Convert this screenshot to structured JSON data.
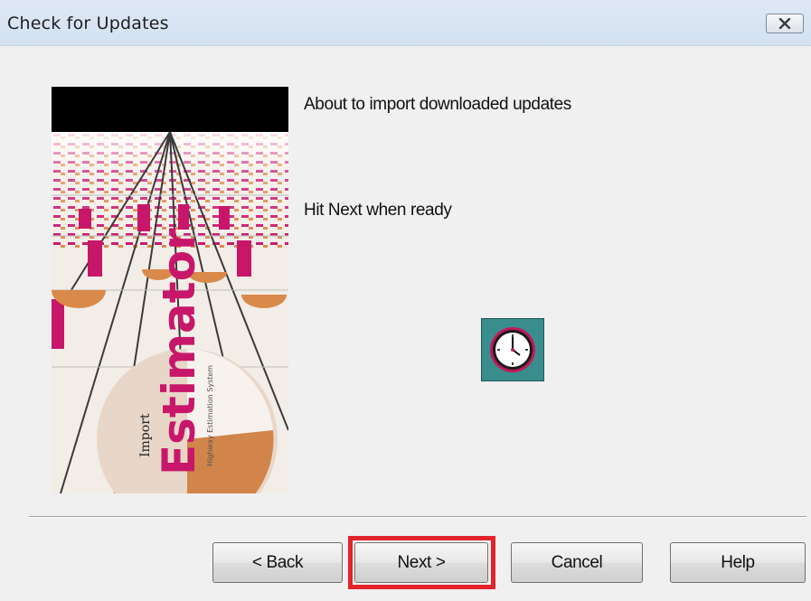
{
  "window": {
    "title": "Check for Updates",
    "close_icon": "close-icon"
  },
  "banner": {
    "image": "estimator-banner-image",
    "word_top": "Import",
    "word_main": "Estimator",
    "word_sub": "Highway Estimation System"
  },
  "content": {
    "message_1": "About to import downloaded updates",
    "message_2": "Hit Next when ready",
    "status_icon": "clock-icon"
  },
  "buttons": {
    "back_label": "< Back",
    "next_label": "Next >",
    "cancel_label": "Cancel",
    "help_label": "Help"
  },
  "colors": {
    "highlight": "#e3232b",
    "clock_background": "#3a8d8d",
    "clock_rim": "#c2185b",
    "banner_magenta": "#c8176a",
    "banner_orange": "#d98a4a"
  }
}
